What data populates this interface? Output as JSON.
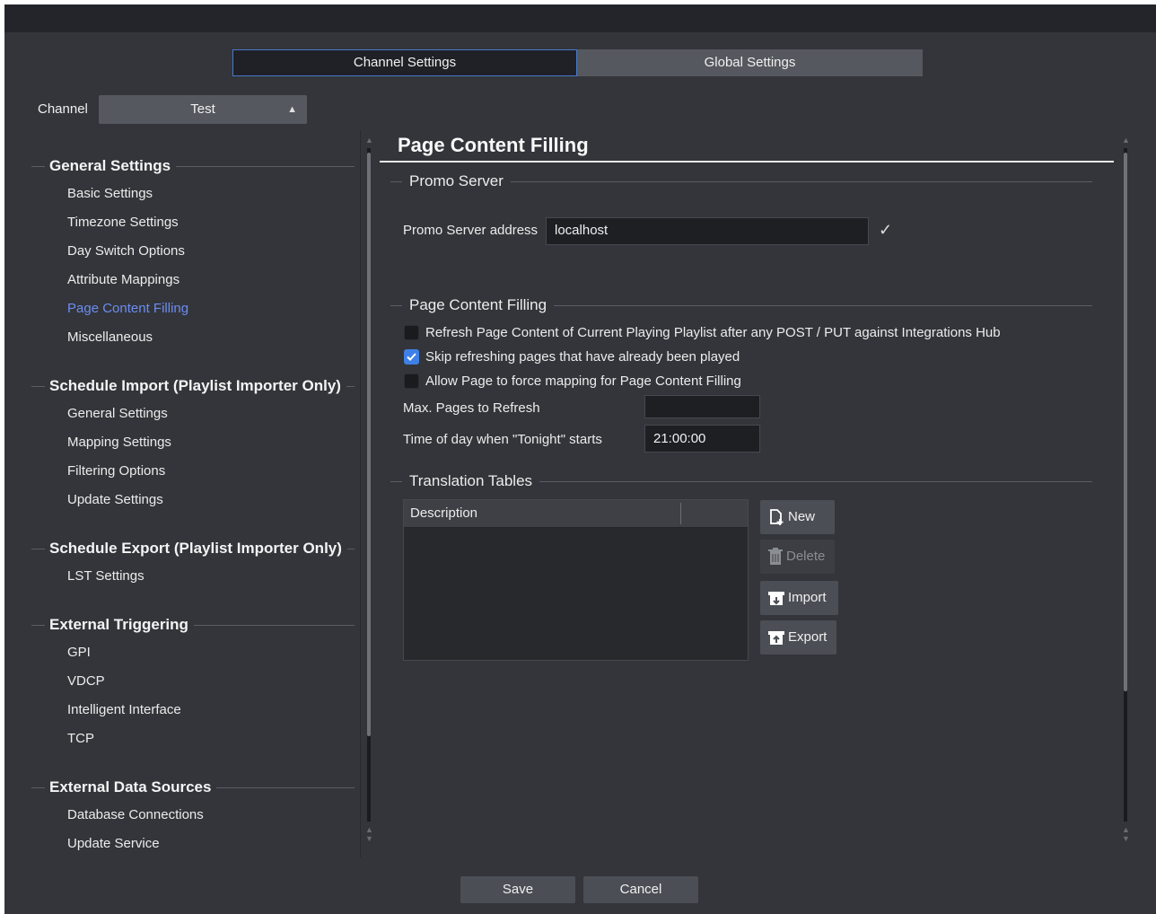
{
  "tabs": {
    "channel_settings": "Channel Settings",
    "global_settings": "Global Settings"
  },
  "channel": {
    "label": "Channel",
    "selected": "Test"
  },
  "sidebar": {
    "sections": [
      {
        "title": "General Settings",
        "items": [
          "Basic Settings",
          "Timezone Settings",
          "Day Switch Options",
          "Attribute Mappings",
          "Page Content Filling",
          "Miscellaneous"
        ]
      },
      {
        "title": "Schedule Import (Playlist Importer Only)",
        "items": [
          "General Settings",
          "Mapping Settings",
          "Filtering Options",
          "Update Settings"
        ]
      },
      {
        "title": "Schedule Export (Playlist Importer Only)",
        "items": [
          "LST Settings"
        ]
      },
      {
        "title": "External Triggering",
        "items": [
          "GPI",
          "VDCP",
          "Intelligent Interface",
          "TCP"
        ]
      },
      {
        "title": "External Data Sources",
        "items": [
          "Database Connections",
          "Update Service"
        ]
      }
    ],
    "active_item": "Page Content Filling"
  },
  "content": {
    "title": "Page Content Filling",
    "promo_server": {
      "heading": "Promo Server",
      "address_label": "Promo Server address",
      "address_value": "localhost"
    },
    "page_content_filling": {
      "heading": "Page Content Filling",
      "checkboxes": [
        {
          "label": "Refresh Page Content of Current Playing Playlist after any POST / PUT against Integrations Hub",
          "checked": false
        },
        {
          "label": "Skip refreshing pages that have already been played",
          "checked": true
        },
        {
          "label": "Allow Page to force mapping for Page Content Filling",
          "checked": false
        }
      ],
      "max_pages_label": "Max. Pages to Refresh",
      "max_pages_value": "",
      "tonight_label": "Time of day when \"Tonight\" starts",
      "tonight_value": "21:00:00"
    },
    "translation_tables": {
      "heading": "Translation Tables",
      "columns": [
        "Description"
      ],
      "rows": [],
      "buttons": {
        "new": "New",
        "delete": "Delete",
        "import": "Import",
        "export": "Export"
      }
    }
  },
  "footer": {
    "save": "Save",
    "cancel": "Cancel"
  },
  "colors": {
    "accent": "#4a78c8",
    "active_nav": "#6c8cf0",
    "checkbox_on": "#3e80e6",
    "background": "#33353a"
  }
}
